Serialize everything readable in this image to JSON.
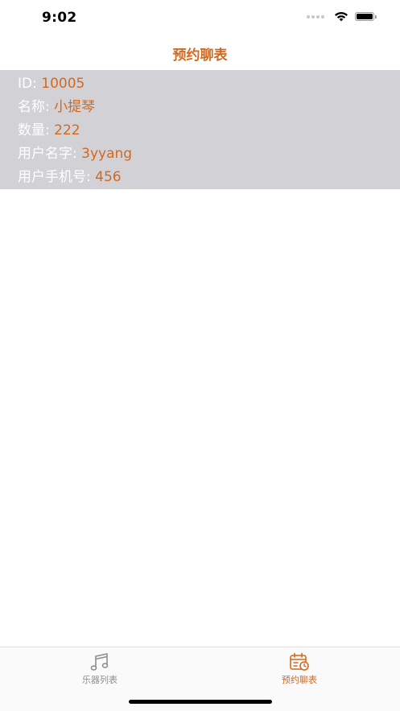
{
  "status_bar": {
    "time": "9:02"
  },
  "nav": {
    "title": "预约聊表"
  },
  "record": {
    "id_label": "ID: ",
    "id_value": "10005",
    "name_label": "名称: ",
    "name_value": "小提琴",
    "qty_label": "数量: ",
    "qty_value": "222",
    "user_label": "用户名字: ",
    "user_value": "3yyang",
    "phone_label": "用户手机号: ",
    "phone_value": "456"
  },
  "tabs": [
    {
      "label": "乐器列表",
      "icon": "music-note-icon",
      "active": false
    },
    {
      "label": "预约聊表",
      "icon": "calendar-clock-icon",
      "active": true
    }
  ],
  "colors": {
    "accent": "#d2691e",
    "card_bg": "#d1d1d6",
    "inactive": "#8e8e93"
  }
}
